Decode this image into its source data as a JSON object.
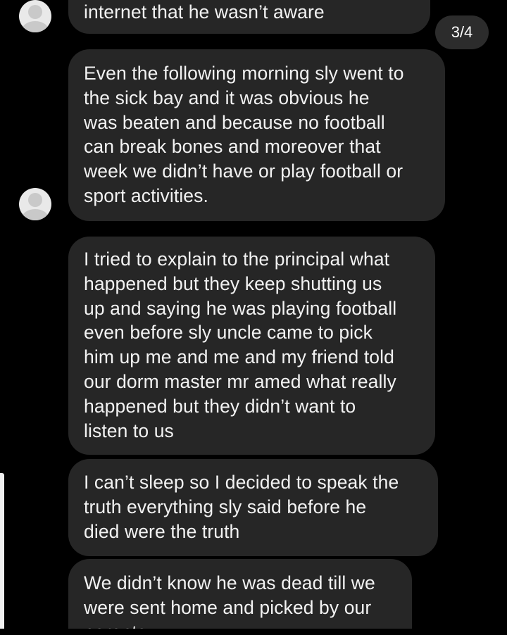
{
  "pager": {
    "label": "3/4"
  },
  "messages": [
    {
      "lines": [
        "internet that he wasn’t aware"
      ]
    },
    {
      "lines": [
        "Even the following morning sly went to",
        "the sick bay and it was obvious he",
        "was beaten and because no football",
        "can break bones and moreover that",
        "week we didn’t have or play football or",
        "sport activities."
      ]
    },
    {
      "lines": [
        "I tried to explain to the principal what",
        "happened but they keep shutting us",
        "up and saying he was playing football",
        "even before sly uncle came to pick",
        "him up me and me and my friend told",
        "our dorm master mr amed what really",
        "happened but they didn’t want to",
        "listen to us"
      ]
    },
    {
      "lines": [
        "I can’t sleep so I decided to speak the",
        "truth everything sly said before he",
        "died were the truth"
      ]
    },
    {
      "lines": [
        "We didn’t know he was dead till we",
        "were sent home and picked by our",
        "parents"
      ]
    }
  ],
  "colors": {
    "background": "#000000",
    "bubble": "#262626",
    "text": "#f2f2f2",
    "badge": "#2c2c2c"
  },
  "icons": {
    "avatar": "default-profile-avatar-icon"
  }
}
